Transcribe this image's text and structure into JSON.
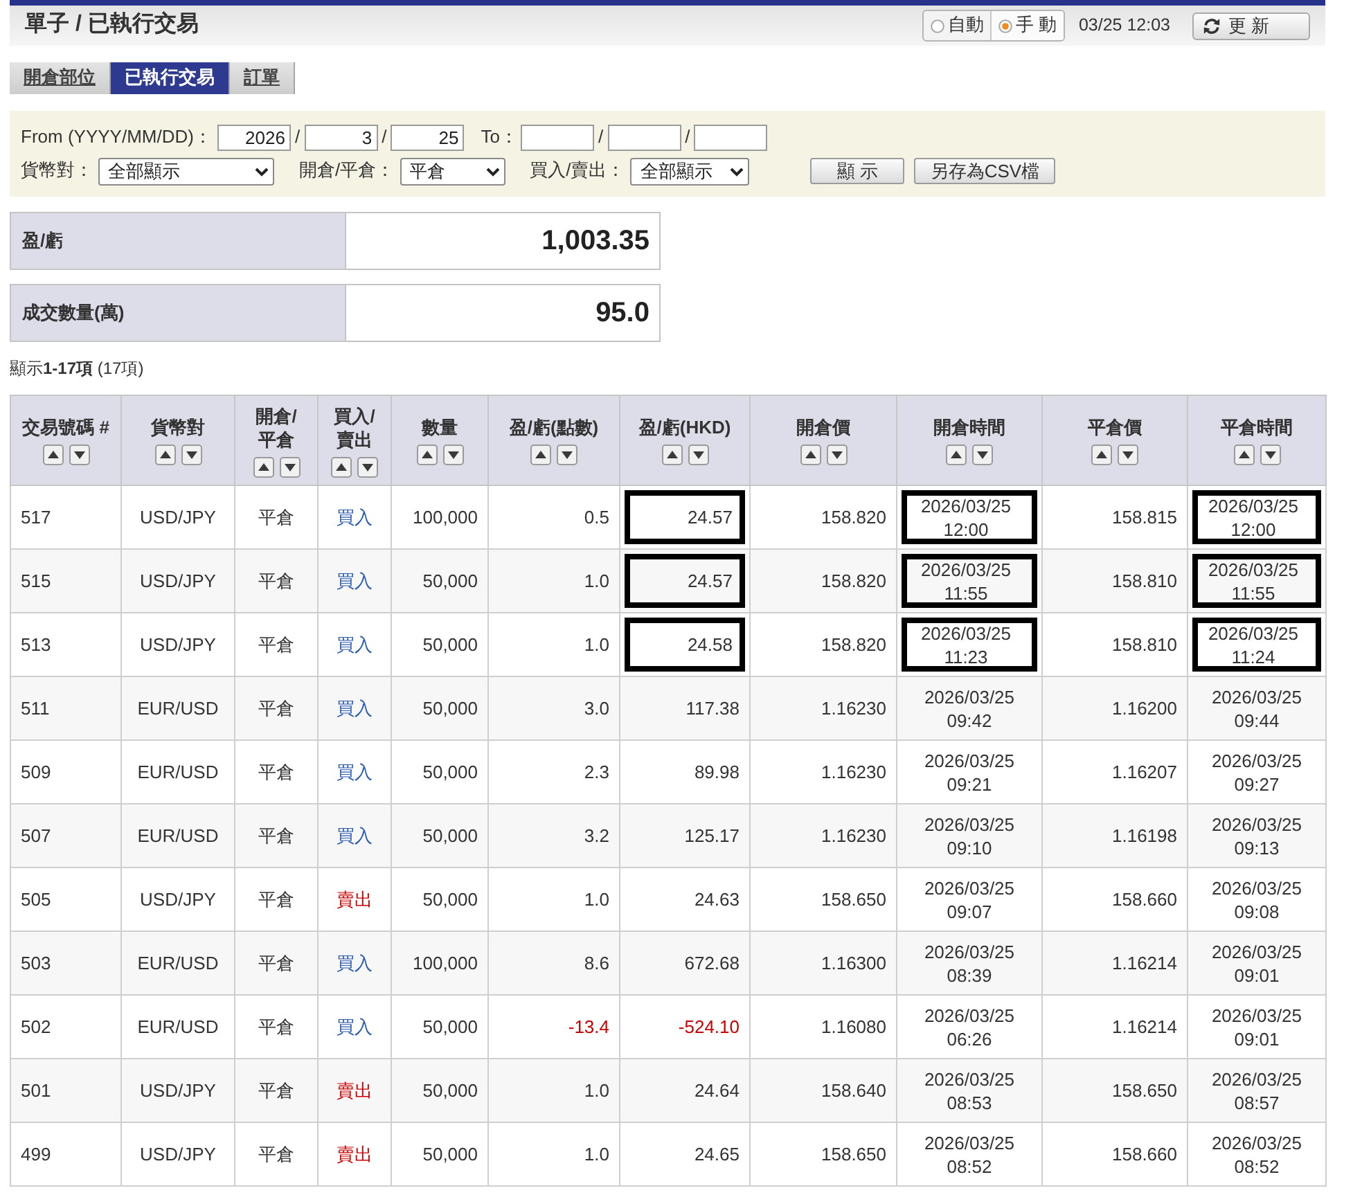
{
  "header": {
    "title": "單子 / 已執行交易",
    "modes": [
      {
        "label": "自動",
        "selected": false
      },
      {
        "label": "手 動",
        "selected": true
      }
    ],
    "time": "03/25 12:03",
    "refresh_button": "更 新"
  },
  "tabs": [
    {
      "label": "開倉部位",
      "selected": false
    },
    {
      "label": "已執行交易",
      "selected": true
    },
    {
      "label": "訂單",
      "selected": false
    }
  ],
  "filters": {
    "from": {
      "label": "From (YYYY/MM/DD)：",
      "fields": [
        "2026",
        "3",
        "25"
      ],
      "separators": [
        "/",
        "/"
      ]
    },
    "to": {
      "label": "To：",
      "separators": [
        "/",
        "/"
      ]
    },
    "selects": [
      {
        "label": "貨幣對：",
        "value": "全部顯示"
      },
      {
        "label": "開倉/平倉：",
        "value": "平倉"
      },
      {
        "label": "買入/賣出：",
        "value": "全部顯示"
      }
    ],
    "buttons": [
      "顯 示",
      "另存為CSV檔"
    ]
  },
  "summary": [
    {
      "label": "盈/虧",
      "value": "1,003.35"
    },
    {
      "label": "成交數量(萬)",
      "value": "95.0"
    }
  ],
  "result_count": "顯示**1-17項** (17項)",
  "table": {
    "columns": [
      {
        "label": "交易號碼 #"
      },
      {
        "label": "貨幣對"
      },
      {
        "label": "開倉/平倉"
      },
      {
        "label": "買入/賣出"
      },
      {
        "label": "數量"
      },
      {
        "label": "盈/虧(點數)"
      },
      {
        "label": "盈/虧(HKD)"
      },
      {
        "label": "開倉價"
      },
      {
        "label": "開倉時間"
      },
      {
        "label": "平倉價"
      },
      {
        "label": "平倉時間"
      }
    ],
    "rows": [
      {
        "id": "517",
        "pair": "USD/JPY",
        "action": "平倉",
        "side": {
          "label": "買入",
          "kind": "buy"
        },
        "amount": "100,000",
        "pips": "0.5",
        "pl": "24.57",
        "loss": false,
        "open_price": "158.820",
        "open_time": "2026/03/25 12:00",
        "close_price": "158.815",
        "close_time": "2026/03/25 12:00",
        "marked": true
      },
      {
        "id": "515",
        "pair": "USD/JPY",
        "action": "平倉",
        "side": {
          "label": "買入",
          "kind": "buy"
        },
        "amount": "50,000",
        "pips": "1.0",
        "pl": "24.57",
        "loss": false,
        "open_price": "158.820",
        "open_time": "2026/03/25 11:55",
        "close_price": "158.810",
        "close_time": "2026/03/25 11:55",
        "marked": true
      },
      {
        "id": "513",
        "pair": "USD/JPY",
        "action": "平倉",
        "side": {
          "label": "買入",
          "kind": "buy"
        },
        "amount": "50,000",
        "pips": "1.0",
        "pl": "24.58",
        "loss": false,
        "open_price": "158.820",
        "open_time": "2026/03/25 11:23",
        "close_price": "158.810",
        "close_time": "2026/03/25 11:24",
        "marked": true
      },
      {
        "id": "511",
        "pair": "EUR/USD",
        "action": "平倉",
        "side": {
          "label": "買入",
          "kind": "buy"
        },
        "amount": "50,000",
        "pips": "3.0",
        "pl": "117.38",
        "loss": false,
        "open_price": "1.16230",
        "open_time": "2026/03/25 09:42",
        "close_price": "1.16200",
        "close_time": "2026/03/25 09:44",
        "marked": false
      },
      {
        "id": "509",
        "pair": "EUR/USD",
        "action": "平倉",
        "side": {
          "label": "買入",
          "kind": "buy"
        },
        "amount": "50,000",
        "pips": "2.3",
        "pl": "89.98",
        "loss": false,
        "open_price": "1.16230",
        "open_time": "2026/03/25 09:21",
        "close_price": "1.16207",
        "close_time": "2026/03/25 09:27",
        "marked": false
      },
      {
        "id": "507",
        "pair": "EUR/USD",
        "action": "平倉",
        "side": {
          "label": "買入",
          "kind": "buy"
        },
        "amount": "50,000",
        "pips": "3.2",
        "pl": "125.17",
        "loss": false,
        "open_price": "1.16230",
        "open_time": "2026/03/25 09:10",
        "close_price": "1.16198",
        "close_time": "2026/03/25 09:13",
        "marked": false
      },
      {
        "id": "505",
        "pair": "USD/JPY",
        "action": "平倉",
        "side": {
          "label": "賣出",
          "kind": "sell"
        },
        "amount": "50,000",
        "pips": "1.0",
        "pl": "24.63",
        "loss": false,
        "open_price": "158.650",
        "open_time": "2026/03/25 09:07",
        "close_price": "158.660",
        "close_time": "2026/03/25 09:08",
        "marked": false
      },
      {
        "id": "503",
        "pair": "EUR/USD",
        "action": "平倉",
        "side": {
          "label": "買入",
          "kind": "buy"
        },
        "amount": "100,000",
        "pips": "8.6",
        "pl": "672.68",
        "loss": false,
        "open_price": "1.16300",
        "open_time": "2026/03/25 08:39",
        "close_price": "1.16214",
        "close_time": "2026/03/25 09:01",
        "marked": false
      },
      {
        "id": "502",
        "pair": "EUR/USD",
        "action": "平倉",
        "side": {
          "label": "買入",
          "kind": "buy"
        },
        "amount": "50,000",
        "pips": "-13.4",
        "pl": "-524.10",
        "loss": true,
        "open_price": "1.16080",
        "open_time": "2026/03/25 06:26",
        "close_price": "1.16214",
        "close_time": "2026/03/25 09:01",
        "marked": false
      },
      {
        "id": "501",
        "pair": "USD/JPY",
        "action": "平倉",
        "side": {
          "label": "賣出",
          "kind": "sell"
        },
        "amount": "50,000",
        "pips": "1.0",
        "pl": "24.64",
        "loss": false,
        "open_price": "158.640",
        "open_time": "2026/03/25 08:53",
        "close_price": "158.650",
        "close_time": "2026/03/25 08:57",
        "marked": false
      },
      {
        "id": "499",
        "pair": "USD/JPY",
        "action": "平倉",
        "side": {
          "label": "賣出",
          "kind": "sell"
        },
        "amount": "50,000",
        "pips": "1.0",
        "pl": "24.65",
        "loss": false,
        "open_price": "158.650",
        "open_time": "2026/03/25 08:52",
        "close_price": "158.660",
        "close_time": "2026/03/25 08:52",
        "marked": false
      }
    ]
  }
}
